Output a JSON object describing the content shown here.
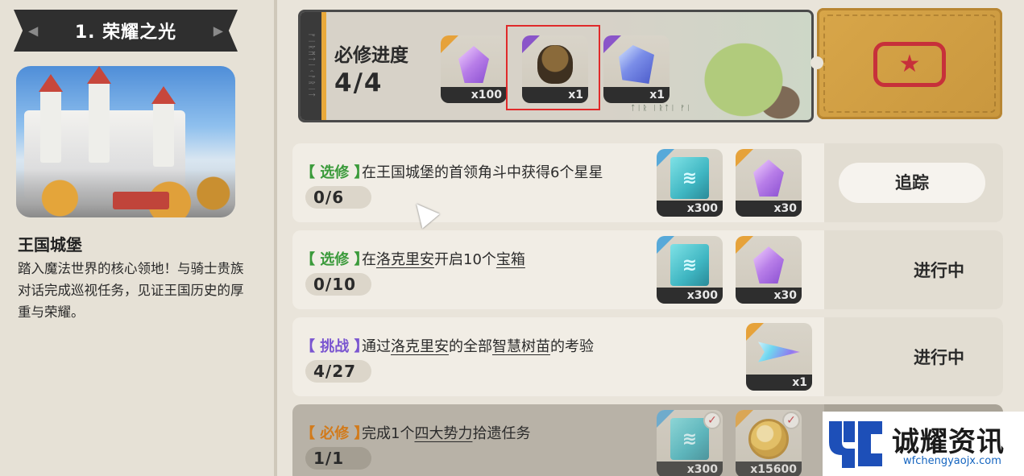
{
  "chapter": {
    "title": "1. 荣耀之光",
    "prev_icon": "chevron-left-icon",
    "next_icon": "chevron-right-icon"
  },
  "region": {
    "name": "王国城堡",
    "description": "踏入魔法世界的核心领地！与骑士贵族对话完成巡视任务，见证王国历史的厚重与荣耀。"
  },
  "required_progress": {
    "label": "必修进度",
    "value": "4/4",
    "items": [
      {
        "icon": "purple-crystal-icon",
        "count": "x100",
        "rarity_color": "#e6a23a"
      },
      {
        "icon": "acorn-icon",
        "count": "x1",
        "rarity_color": "#8a55c9"
      },
      {
        "icon": "blue-crystal-icon",
        "count": "x1",
        "rarity_color": "#8a55c9"
      }
    ]
  },
  "quests": [
    {
      "tag": "【 选修 】",
      "tag_color": "#3a9a3a",
      "text_parts": [
        "在王国城堡的首领角斗中获得6个星星"
      ],
      "progress": "0/6",
      "rewards": [
        {
          "icon": "skill-book-icon",
          "count": "x300"
        },
        {
          "icon": "purple-crystal-icon",
          "count": "x30"
        }
      ],
      "action": "追踪"
    },
    {
      "tag": "【 选修 】",
      "tag_color": "#3a9a3a",
      "text_parts": [
        "在",
        "洛克里安",
        "开启10个",
        "宝箱"
      ],
      "progress": "0/10",
      "rewards": [
        {
          "icon": "skill-book-icon",
          "count": "x300"
        },
        {
          "icon": "purple-crystal-icon",
          "count": "x30"
        }
      ],
      "status": "进行中"
    },
    {
      "tag": "【 挑战 】",
      "tag_color": "#7a55d0",
      "text_parts": [
        "通过",
        "洛克里安",
        "的全部",
        "智慧树苗",
        "的考验"
      ],
      "progress": "4/27",
      "rewards": [
        {
          "icon": "prism-crystal-icon",
          "count": "x1"
        }
      ],
      "status": "进行中"
    },
    {
      "tag": "【 必修 】",
      "tag_color": "#d27a1a",
      "text_parts": [
        "完成1个",
        "四大势力",
        "拾遗任务"
      ],
      "progress": "1/1",
      "rewards": [
        {
          "icon": "skill-book-icon",
          "count": "x300",
          "claimed": true
        },
        {
          "icon": "gold-coin-icon",
          "count": "x15600",
          "claimed": true
        }
      ]
    }
  ],
  "watermark": {
    "brand": "诚耀资讯",
    "url": "wfchengyaojx.com"
  },
  "colors": {
    "background": "#e9e4da",
    "highlight": "#e02a2a",
    "ticket": "#d8a649",
    "emblem": "#c7303a"
  }
}
